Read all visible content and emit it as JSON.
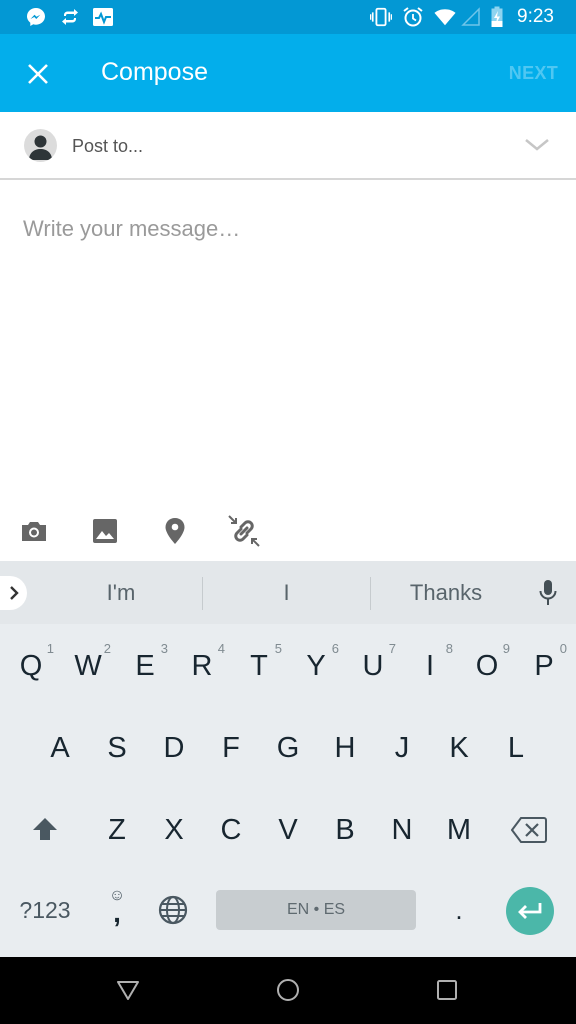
{
  "status_bar": {
    "time": "9:23",
    "left_icons": [
      "messenger-icon",
      "sync-icon",
      "activity-monitor-icon"
    ],
    "right_icons": [
      "vibrate-icon",
      "alarm-icon",
      "wifi-icon",
      "cellular-signal-icon",
      "battery-charging-icon"
    ],
    "background": "#0398d4"
  },
  "app_bar": {
    "title": "Compose",
    "close_icon": "close-icon",
    "next_label": "NEXT",
    "next_enabled": false,
    "background": "#03aeeb"
  },
  "post_to": {
    "placeholder": "Post to...",
    "avatar_icon": "person-icon",
    "chevron_icon": "chevron-down-icon"
  },
  "message": {
    "placeholder": "Write your message…",
    "value": ""
  },
  "attach_toolbar": {
    "items": [
      {
        "name": "camera",
        "icon": "camera-icon"
      },
      {
        "name": "gallery",
        "icon": "image-icon"
      },
      {
        "name": "location",
        "icon": "location-pin-icon"
      },
      {
        "name": "link",
        "icon": "link-icon"
      }
    ]
  },
  "keyboard": {
    "suggestions": [
      "I'm",
      "I",
      "Thanks"
    ],
    "row1": [
      {
        "key": "Q",
        "hint": "1"
      },
      {
        "key": "W",
        "hint": "2"
      },
      {
        "key": "E",
        "hint": "3"
      },
      {
        "key": "R",
        "hint": "4"
      },
      {
        "key": "T",
        "hint": "5"
      },
      {
        "key": "Y",
        "hint": "6"
      },
      {
        "key": "U",
        "hint": "7"
      },
      {
        "key": "I",
        "hint": "8"
      },
      {
        "key": "O",
        "hint": "9"
      },
      {
        "key": "P",
        "hint": "0"
      }
    ],
    "row2": [
      "A",
      "S",
      "D",
      "F",
      "G",
      "H",
      "J",
      "K",
      "L"
    ],
    "row3": [
      "Z",
      "X",
      "C",
      "V",
      "B",
      "N",
      "M"
    ],
    "symbols_label": "?123",
    "comma_label": ",",
    "emoji_hint": "☺",
    "space_label": "EN • ES",
    "period_label": ".",
    "enter_color": "#4bb7a9"
  },
  "nav_bar": {
    "buttons": [
      "back-icon",
      "home-icon",
      "recents-icon"
    ]
  }
}
